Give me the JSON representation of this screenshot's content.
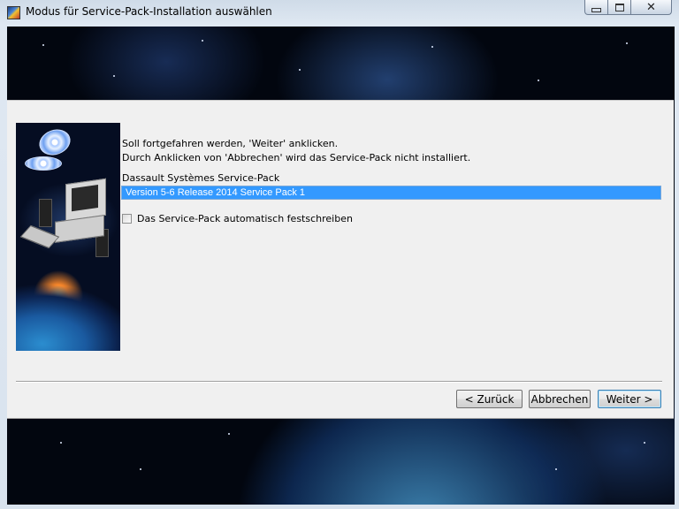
{
  "window": {
    "title": "Modus für Service-Pack-Installation auswählen",
    "controls": {
      "minimize": "minimize",
      "maximize": "maximize",
      "close": "✕"
    }
  },
  "dialog": {
    "instruction_line1": "Soll fortgefahren werden, 'Weiter' anklicken.",
    "instruction_line2": "Durch Anklicken von 'Abbrechen' wird das Service-Pack nicht installiert.",
    "list_label": "Dassault Systèmes Service-Pack",
    "list_items": [
      {
        "label": "Version 5-6 Release 2014 Service Pack 1",
        "selected": true
      }
    ],
    "checkbox": {
      "label": "Das Service-Pack automatisch festschreiben",
      "checked": false
    },
    "buttons": {
      "back": "< Zurück",
      "cancel": "Abbrechen",
      "next": "Weiter >"
    }
  },
  "colors": {
    "selection": "#3399ff",
    "panel": "#f0f0f0",
    "space_background": "#02060f"
  },
  "icons": {
    "app": "app-icon",
    "side_image": "setup-computer-illustration"
  }
}
